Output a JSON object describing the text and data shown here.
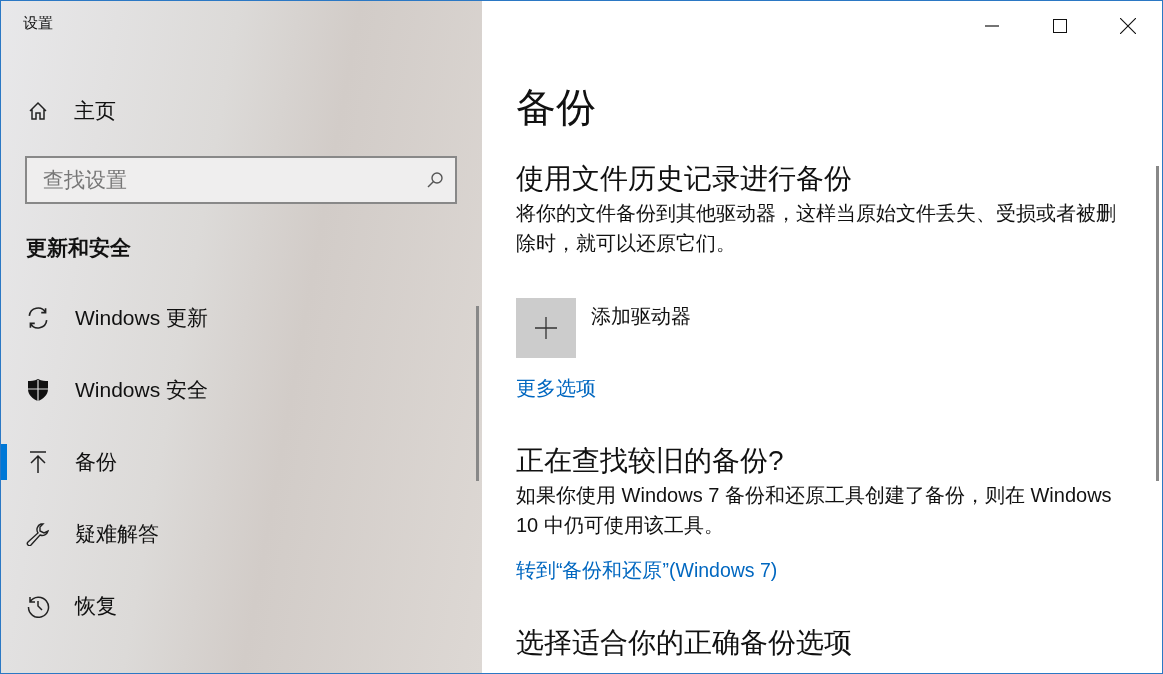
{
  "window": {
    "title": "设置"
  },
  "sidebar": {
    "home": {
      "label": "主页"
    },
    "search": {
      "placeholder": "查找设置"
    },
    "section_title": "更新和安全",
    "items": [
      {
        "label": "Windows 更新",
        "selected": false
      },
      {
        "label": "Windows 安全",
        "selected": false
      },
      {
        "label": "备份",
        "selected": true
      },
      {
        "label": "疑难解答",
        "selected": false
      },
      {
        "label": "恢复",
        "selected": false
      }
    ]
  },
  "main": {
    "title": "备份",
    "sections": [
      {
        "heading": "使用文件历史记录进行备份",
        "description": "将你的文件备份到其他驱动器，这样当原始文件丢失、受损或者被删除时，就可以还原它们。",
        "add_drive": {
          "label": "添加驱动器"
        },
        "link": "更多选项"
      },
      {
        "heading": "正在查找较旧的备份?",
        "description": "如果你使用 Windows 7 备份和还原工具创建了备份，则在 Windows 10 中仍可使用该工具。",
        "link": "转到“备份和还原”(Windows 7)"
      },
      {
        "heading": "选择适合你的正确备份选项"
      }
    ]
  }
}
